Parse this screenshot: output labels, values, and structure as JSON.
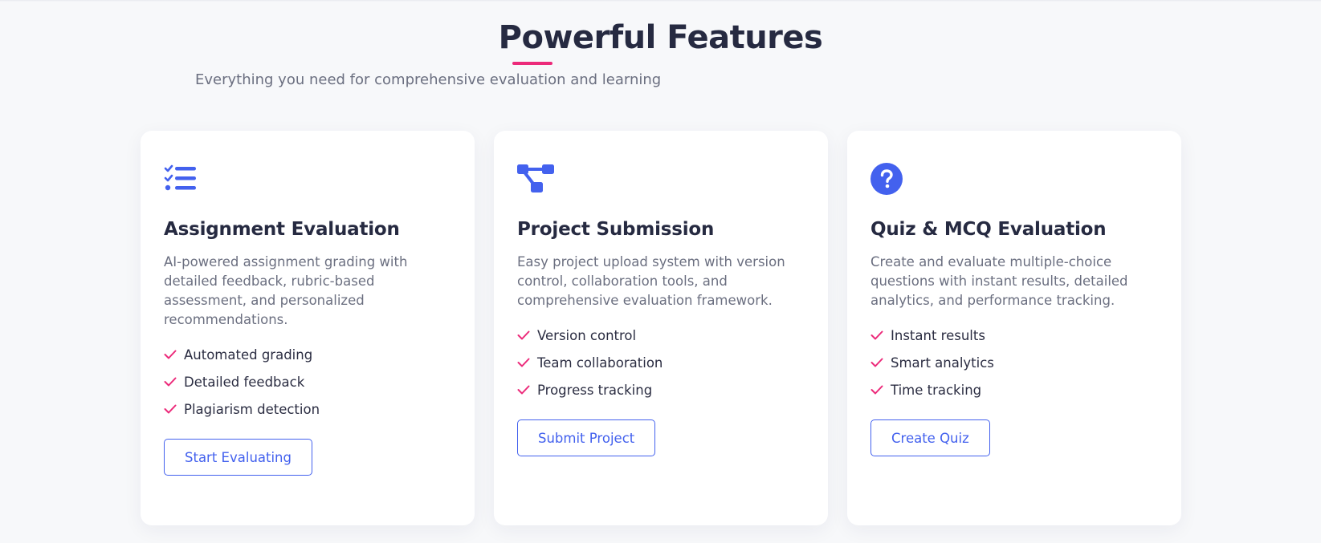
{
  "section": {
    "title": "Powerful Features",
    "subtitle": "Everything you need for comprehensive evaluation and learning"
  },
  "colors": {
    "accent": "#4361ee",
    "highlight": "#ec2a7a",
    "heading": "#262a41",
    "muted": "#6b6f80"
  },
  "cards": [
    {
      "icon": "checklist-icon",
      "title": "Assignment Evaluation",
      "description": "AI-powered assignment grading with detailed feedback, rubric-based assessment, and personalized recommendations.",
      "features": [
        "Automated grading",
        "Detailed feedback",
        "Plagiarism detection"
      ],
      "button_label": "Start Evaluating"
    },
    {
      "icon": "project-diagram-icon",
      "title": "Project Submission",
      "description": "Easy project upload system with version control, collaboration tools, and comprehensive evaluation framework.",
      "features": [
        "Version control",
        "Team collaboration",
        "Progress tracking"
      ],
      "button_label": "Submit Project"
    },
    {
      "icon": "question-circle-icon",
      "title": "Quiz & MCQ Evaluation",
      "description": "Create and evaluate multiple-choice questions with instant results, detailed analytics, and performance tracking.",
      "features": [
        "Instant results",
        "Smart analytics",
        "Time tracking"
      ],
      "button_label": "Create Quiz"
    }
  ]
}
